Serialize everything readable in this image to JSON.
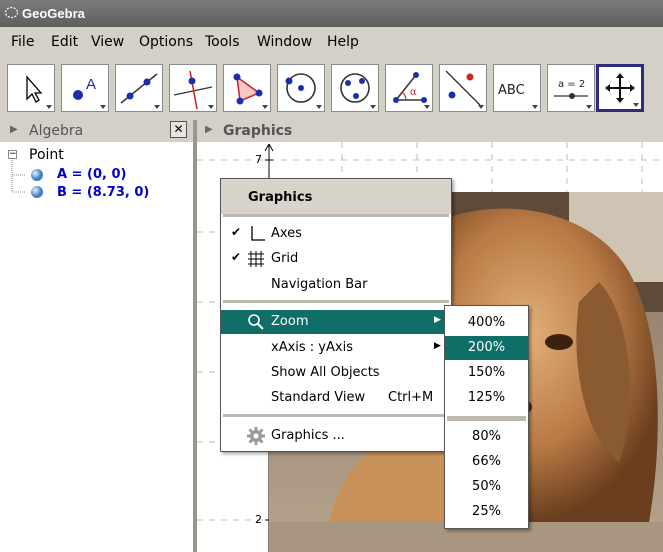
{
  "window": {
    "title": "GeoGebra"
  },
  "menu": [
    "File",
    "Edit",
    "View",
    "Options",
    "Tools",
    "Window",
    "Help"
  ],
  "toolbar": {
    "tools": [
      {
        "name": "move-tool",
        "icon": "arrow-pointer-icon"
      },
      {
        "name": "point-tool",
        "icon": "point-icon",
        "text": "A"
      },
      {
        "name": "line-tool",
        "icon": "line-icon"
      },
      {
        "name": "perpendicular-line-tool",
        "icon": "perpendicular-icon"
      },
      {
        "name": "polygon-tool",
        "icon": "polygon-icon"
      },
      {
        "name": "circle-tool",
        "icon": "circle-icon"
      },
      {
        "name": "conic-tool",
        "icon": "conic-icon"
      },
      {
        "name": "angle-tool",
        "icon": "angle-icon",
        "text": "α"
      },
      {
        "name": "reflect-tool",
        "icon": "reflect-icon"
      },
      {
        "name": "text-tool",
        "icon": "text-icon",
        "text": "ABC"
      },
      {
        "name": "slider-tool",
        "icon": "slider-icon",
        "text": "a = 2"
      },
      {
        "name": "move-graphics-view-tool",
        "icon": "move-graphics-icon"
      }
    ]
  },
  "algebra": {
    "title": "Algebra",
    "root": "Point",
    "items": [
      "A = (0, 0)",
      "B = (8.73, 0)"
    ]
  },
  "graphics": {
    "title": "Graphics",
    "y_ticks": [
      "7",
      "2"
    ]
  },
  "context_menu": {
    "title": "Graphics",
    "items": [
      {
        "label": "Axes",
        "checked": true,
        "icon": "axes-icon"
      },
      {
        "label": "Grid",
        "checked": true,
        "icon": "grid-icon"
      },
      {
        "label": "Navigation Bar"
      },
      {
        "label": "Zoom",
        "icon": "zoom-icon",
        "submenu": true,
        "highlighted": true
      },
      {
        "label": "xAxis : yAxis",
        "submenu": true
      },
      {
        "label": "Show All Objects"
      },
      {
        "label": "Standard View",
        "shortcut": "Ctrl+M"
      },
      {
        "label": "Graphics ...",
        "icon": "gear-icon"
      }
    ]
  },
  "zoom_submenu": {
    "in": [
      "400%",
      "200%",
      "150%",
      "125%"
    ],
    "out": [
      "80%",
      "66%",
      "50%",
      "25%"
    ],
    "highlighted": "200%"
  },
  "colors": {
    "highlight": "#0f6f68",
    "algebra_value": "#0000cc",
    "title_bar": "#6a6a6a"
  }
}
